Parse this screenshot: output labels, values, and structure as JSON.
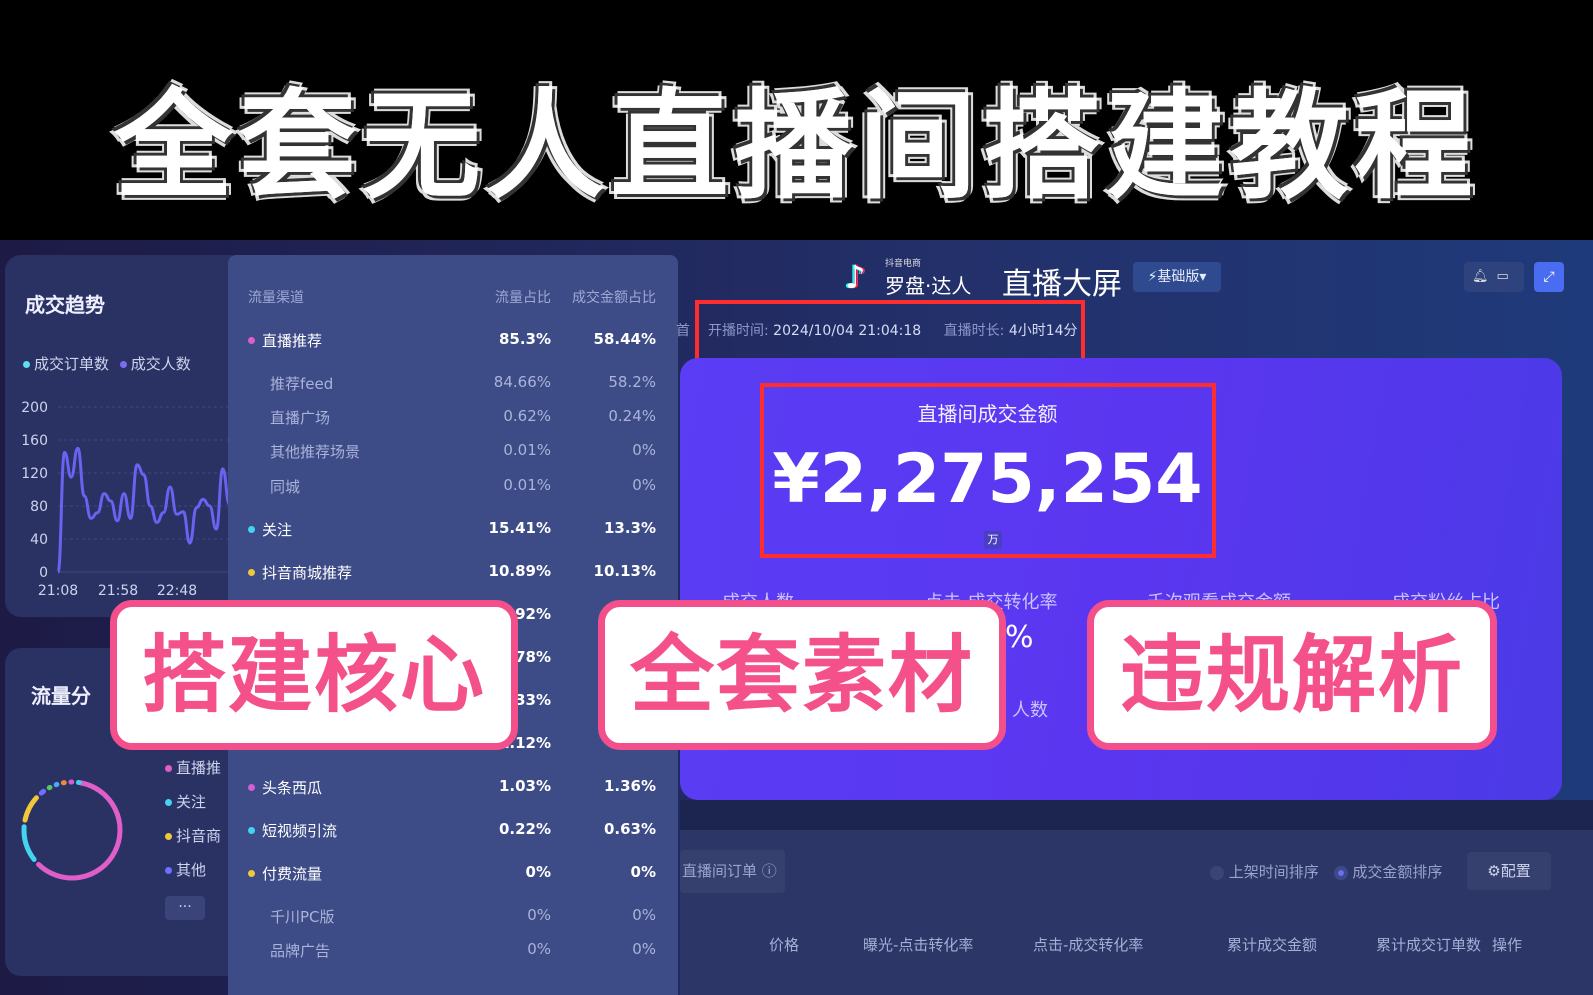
{
  "banner": {
    "title": "全套无人直播间搭建教程"
  },
  "header": {
    "brand_small": "抖音电商",
    "brand": "罗盘·达人",
    "title": "直播大屏",
    "edition": "基础版",
    "start_label": "开播时间:",
    "start_time": "2024/10/04 21:04:18",
    "duration_label": "直播时长:",
    "duration": "4小时14分",
    "prev_tab_fragment": "首"
  },
  "trend": {
    "title": "成交趋势",
    "legend": [
      "成交订单数",
      "成交人数"
    ]
  },
  "chart_data": {
    "type": "line",
    "yticks": [
      "0",
      "40",
      "80",
      "120",
      "160",
      "200"
    ],
    "ylim": [
      0,
      200
    ],
    "xticks": [
      "21:08",
      "21:58",
      "22:48",
      "2"
    ],
    "series": [
      {
        "name": "成交人数",
        "color": "#6a62f0",
        "values": [
          0,
          145,
          115,
          150,
          92,
          65,
          72,
          95,
          86,
          62,
          95,
          65,
          130,
          118,
          80,
          60,
          72,
          103,
          70,
          73,
          35,
          78,
          88,
          80,
          52,
          125,
          82,
          165
        ]
      }
    ],
    "grid": true,
    "legend": "top-left"
  },
  "traffic": {
    "title": "流量分",
    "legend": [
      "直播推",
      "关注",
      "抖音商",
      "其他"
    ],
    "more": "···",
    "donut": [
      {
        "color": "#e05ec8",
        "value": 58
      },
      {
        "color": "#45d4f0",
        "value": 13
      },
      {
        "color": "#f0c838",
        "value": 10
      },
      {
        "color": "#7070ff",
        "value": 3
      },
      {
        "color": "#52c86a",
        "value": 2
      },
      {
        "color": "#4aa6ff",
        "value": 2
      },
      {
        "color": "#f08a3a",
        "value": 2
      },
      {
        "color": "#d060d0",
        "value": 2
      },
      {
        "color": "#40d0e8",
        "value": 2
      }
    ]
  },
  "table": {
    "headers": [
      "流量渠道",
      "流量占比",
      "成交金额占比"
    ],
    "rows": [
      {
        "label": "直播推荐",
        "v1": "85.3%",
        "v2": "58.44%",
        "sub": false,
        "dot": "#e05ec8"
      },
      {
        "label": "推荐feed",
        "v1": "84.66%",
        "v2": "58.2%",
        "sub": true
      },
      {
        "label": "直播广场",
        "v1": "0.62%",
        "v2": "0.24%",
        "sub": true
      },
      {
        "label": "其他推荐场景",
        "v1": "0.01%",
        "v2": "0%",
        "sub": true
      },
      {
        "label": "同城",
        "v1": "0.01%",
        "v2": "0%",
        "sub": true
      },
      {
        "label": "关注",
        "v1": "15.41%",
        "v2": "13.3%",
        "sub": false,
        "dot": "#45d4f0"
      },
      {
        "label": "抖音商城推荐",
        "v1": "10.89%",
        "v2": "10.13%",
        "sub": false,
        "dot": "#f0c838"
      },
      {
        "label": "",
        "v1": ".92%",
        "v2": "",
        "sub": false
      },
      {
        "label": "",
        "v1": ".78%",
        "v2": "",
        "sub": false
      },
      {
        "label": "",
        "v1": ".33%",
        "v2": "",
        "sub": false
      },
      {
        "label": "",
        "v1": "1.12%",
        "v2": "",
        "sub": false
      },
      {
        "label": "头条西瓜",
        "v1": "1.03%",
        "v2": "1.36%",
        "sub": false,
        "dot": "#d060d0"
      },
      {
        "label": "短视频引流",
        "v1": "0.22%",
        "v2": "0.63%",
        "sub": false,
        "dot": "#45d4f0"
      },
      {
        "label": "付费流量",
        "v1": "0%",
        "v2": "0%",
        "sub": false,
        "dot": "#f0c838"
      },
      {
        "label": "千川PC版",
        "v1": "0%",
        "v2": "0%",
        "sub": true
      },
      {
        "label": "品牌广告",
        "v1": "0%",
        "v2": "0%",
        "sub": true
      }
    ]
  },
  "gmv": {
    "label": "直播间成交金额",
    "value": "¥2,275,254",
    "unit": "万"
  },
  "metrics": {
    "labels": [
      "成交人数",
      "点击-成交转化率",
      "千次观看成交金额",
      "成交粉丝占比"
    ],
    "percent_fragment": "%",
    "sub_label_fragment": "人数"
  },
  "orders": {
    "tab": "直播间订单",
    "sort_options": [
      "上架时间排序",
      "成交金额排序"
    ],
    "selected_sort": "成交金额排序",
    "config": "配置",
    "columns": [
      "价格",
      "曝光-点击转化率",
      "点击-成交转化率",
      "累计成交金额",
      "累计成交订单数",
      "操作"
    ]
  },
  "overlays": [
    "搭建核心",
    "全套素材",
    "违规解析"
  ]
}
